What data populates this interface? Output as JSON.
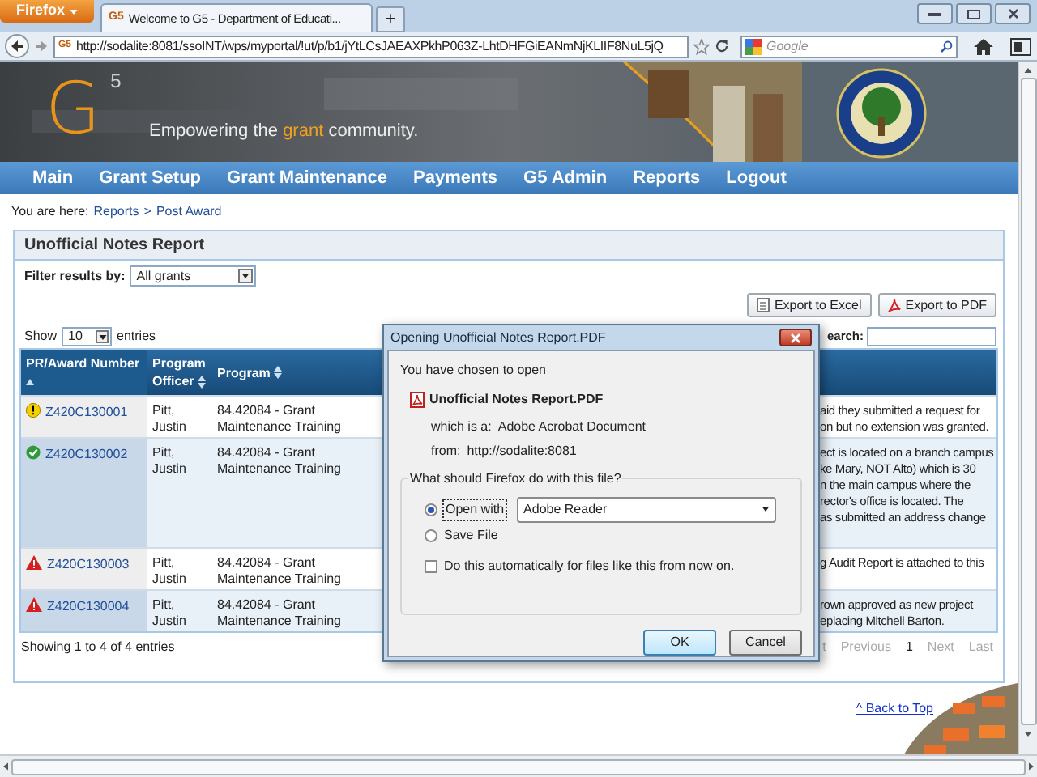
{
  "browser": {
    "menu_button": "Firefox",
    "tabs": [
      {
        "title": "Welcome to G5 - Department of Educati...",
        "favicon": "G5",
        "selected": true
      }
    ],
    "new_tab": "+",
    "address_favicon": "G5",
    "url": "http://sodalite:8081/ssoINT/wps/myportal/!ut/p/b1/jYtLCsJAEAXPkhP063Z-LhtDHFGiEANmNjKLIIF8NuL5jQ",
    "search_placeholder": "Google"
  },
  "banner": {
    "logo_letter": "G",
    "logo_superscript": "5",
    "tagline_before": "Empowering the",
    "tagline_highlight": "grant",
    "tagline_after": "community."
  },
  "nav": [
    {
      "label": "Main"
    },
    {
      "label": "Grant Setup"
    },
    {
      "label": "Grant Maintenance"
    },
    {
      "label": "Payments"
    },
    {
      "label": "G5 Admin"
    },
    {
      "label": "Reports"
    },
    {
      "label": "Logout"
    }
  ],
  "breadcrumb": {
    "prefix": "You are here:",
    "items": [
      "Reports",
      "Post Award"
    ],
    "separator": ">"
  },
  "panel": {
    "title": "Unofficial Notes Report",
    "filter_label": "Filter results by:",
    "filter_value": "All grants",
    "exports": [
      {
        "label": "Export to Excel",
        "kind": "excel"
      },
      {
        "label": "Export to PDF",
        "kind": "pdf"
      }
    ],
    "show_label": "Show",
    "page_size": "10",
    "entries_label": "entries",
    "search_label": "earch:",
    "columns": [
      {
        "label": "PR/Award Number",
        "sorted": true
      },
      {
        "label": "Program Officer",
        "sorted": false
      },
      {
        "label": "Program",
        "sorted": false
      }
    ],
    "rows": [
      {
        "kind": "warning",
        "award": "Z420C130001",
        "officer": "Pitt, Justin",
        "program": "84.42084 - Grant Maintenance Training",
        "notes": [
          "aid they submitted a request for",
          "on but no extension was granted."
        ]
      },
      {
        "kind": "ok",
        "award": "Z420C130002",
        "officer": "Pitt, Justin",
        "program": "84.42084 - Grant Maintenance Training",
        "notes": [
          "ect is located on a branch campus",
          "ke Mary, NOT Alto) which is 30",
          "n the main campus where the",
          "rector's office is located. The",
          "as submitted an address change"
        ]
      },
      {
        "kind": "alert",
        "award": "Z420C130003",
        "officer": "Pitt, Justin",
        "program": "84.42084 - Grant Maintenance Training",
        "notes": [
          "g Audit Report is attached to this"
        ]
      },
      {
        "kind": "alert",
        "award": "Z420C130004",
        "officer": "Pitt, Justin",
        "program": "84.42084 - Grant Maintenance Training",
        "notes": [
          "rown approved as new project",
          "eplacing Mitchell Barton."
        ]
      }
    ],
    "info": "Showing 1 to 4 of 4 entries",
    "pagination": [
      {
        "label": "t",
        "selected": false
      },
      {
        "label": "Previous",
        "selected": false
      },
      {
        "label": "1",
        "selected": true
      },
      {
        "label": "Next",
        "selected": false
      },
      {
        "label": "Last",
        "selected": false
      }
    ]
  },
  "back_to_top": "^ Back to Top",
  "dialog": {
    "title": "Opening Unofficial Notes Report.PDF",
    "intro": "You have chosen to open",
    "file_name": "Unofficial Notes Report.PDF",
    "type_label": "which is a:",
    "type_value": "Adobe Acrobat Document",
    "from_label": "from:",
    "from_value": "http://sodalite:8081",
    "question": "What should Firefox do with this file?",
    "options": [
      {
        "label": "Open with",
        "selected": true
      },
      {
        "label": "Save File",
        "selected": false
      }
    ],
    "app": "Adobe Reader",
    "auto_label": "Do this automatically for files like this from now on.",
    "auto_checked": false,
    "buttons": [
      {
        "label": "OK",
        "default": true
      },
      {
        "label": "Cancel",
        "default": false
      }
    ]
  }
}
